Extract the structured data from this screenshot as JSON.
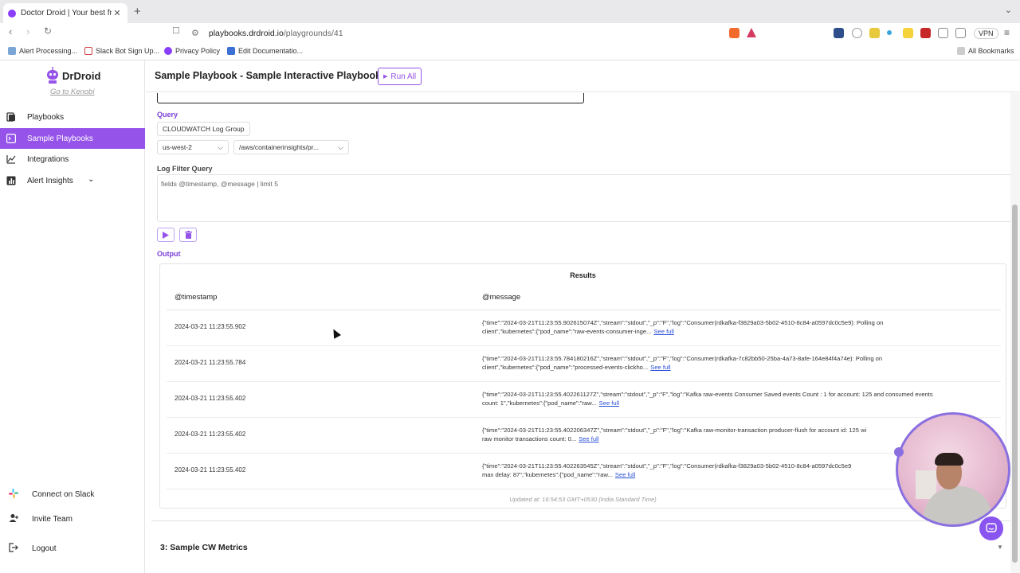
{
  "browser": {
    "tab_title": "Doctor Droid | Your best frien",
    "url_host": "playbooks.drdroid.io",
    "url_path": "/playgrounds/41",
    "vpn_label": "VPN",
    "bookmarks": [
      "Alert Processing...",
      "Slack Bot Sign Up...",
      "Privacy Policy",
      "Edit Documentatio..."
    ],
    "all_bookmarks": "All Bookmarks"
  },
  "sidebar": {
    "brand": "DrDroid",
    "link": "Go to Kenobi",
    "items": [
      {
        "label": "Playbooks",
        "icon": "book-icon"
      },
      {
        "label": "Sample Playbooks",
        "icon": "terminal-icon"
      },
      {
        "label": "Integrations",
        "icon": "chart-icon"
      },
      {
        "label": "Alert Insights",
        "icon": "bar-chart-icon"
      }
    ],
    "footer": [
      {
        "label": "Connect on Slack",
        "icon": "slack-icon"
      },
      {
        "label": "Invite Team",
        "icon": "user-plus-icon"
      },
      {
        "label": "Logout",
        "icon": "logout-icon"
      }
    ]
  },
  "header": {
    "title": "Sample Playbook - Sample Interactive Playbook",
    "run_all": "Run All"
  },
  "query": {
    "label": "Query",
    "source": "CLOUDWATCH Log Group",
    "region": "us-west-2",
    "log_group": "/aws/containerinsights/pr...",
    "filter_label": "Log Filter Query",
    "filter_value": "fields @timestamp, @message | limit 5"
  },
  "output": {
    "label": "Output",
    "results_title": "Results",
    "columns": [
      "@timestamp",
      "@message"
    ],
    "see_full": "See full",
    "rows": [
      {
        "timestamp": "2024-03-21 11:23:55.902",
        "line1": "{\"time\":\"2024-03-21T11:23:55.902615074Z\",\"stream\":\"stdout\",\"_p\":\"F\",\"log\":\"Consumer(rdkafka-f3829a03-5b02-4510-8c84-a0597dc0c5e9): Polling on",
        "line2": "client\",\"kubernetes\":{\"pod_name\":\"raw-events-consumer-inge..."
      },
      {
        "timestamp": "2024-03-21 11:23:55.784",
        "line1": "{\"time\":\"2024-03-21T11:23:55.784180216Z\",\"stream\":\"stdout\",\"_p\":\"F\",\"log\":\"Consumer(rdkafka-7c82bb50-25ba-4a73-8afe-164e84f4a74e): Polling on",
        "line2": "client\",\"kubernetes\":{\"pod_name\":\"processed-events-clickho..."
      },
      {
        "timestamp": "2024-03-21 11:23:55.402",
        "line1": "{\"time\":\"2024-03-21T11:23:55.402261127Z\",\"stream\":\"stdout\",\"_p\":\"F\",\"log\":\"Kafka raw-events Consumer Saved events Count : 1 for account: 125 and consumed events",
        "line2": "count: 1\",\"kubernetes\":{\"pod_name\":\"raw..."
      },
      {
        "timestamp": "2024-03-21 11:23:55.402",
        "line1": "{\"time\":\"2024-03-21T11:23:55.402206347Z\",\"stream\":\"stdout\",\"_p\":\"F\",\"log\":\"Kafka raw-monitor-transaction producer-flush for account id: 125 wi",
        "line2": "raw monitor transactions count: 0..."
      },
      {
        "timestamp": "2024-03-21 11:23:55.402",
        "line1": "{\"time\":\"2024-03-21T11:23:55.402263545Z\",\"stream\":\"stdout\",\"_p\":\"F\",\"log\":\"Consumer(rdkafka-f3829a03-5b02-4510-8c84-a0597dc0c5e9",
        "line2": "max delay: 87\",\"kubernetes\":{\"pod_name\":\"raw..."
      }
    ],
    "updated": "Updated at: 16:54:53 GMT+0530 (India Standard Time)"
  },
  "next_section": "3: Sample CW Metrics",
  "colors": {
    "accent": "#9553e9",
    "link": "#2a4fd6"
  }
}
